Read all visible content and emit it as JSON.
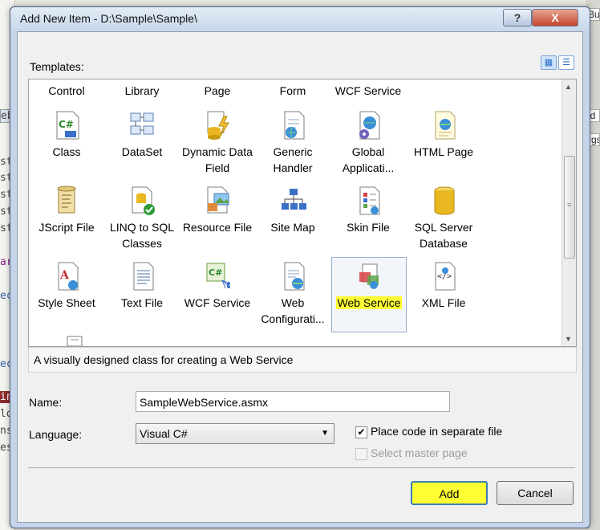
{
  "background": {
    "code_lines": [
      "st",
      "st",
      "st",
      "st",
      "st",
      "ar",
      "ec",
      "ec",
      "in",
      "lo",
      "ns",
      "es"
    ],
    "right_tabs": [
      "Bu",
      "id",
      "rgs"
    ],
    "left_tab": "eb"
  },
  "dialog": {
    "title": "Add New Item - D:\\Sample\\Sample\\",
    "help_label": "?",
    "close_label": "X",
    "templates_label": "Templates:",
    "view_buttons": [
      "large-icons-view-icon",
      "small-icons-view-icon"
    ],
    "top_row_labels": [
      "Control",
      "Library",
      "Page",
      "Form",
      "WCF Service"
    ],
    "items": [
      {
        "label": "Class",
        "icon": "csharp-class-icon"
      },
      {
        "label": "DataSet",
        "icon": "dataset-icon"
      },
      {
        "label": "Dynamic Data Field",
        "icon": "dynamic-data-field-icon"
      },
      {
        "label": "Generic Handler",
        "icon": "generic-handler-icon"
      },
      {
        "label": "Global Applicati...",
        "icon": "global-application-icon"
      },
      {
        "label": "HTML Page",
        "icon": "html-page-icon"
      },
      {
        "label": "JScript File",
        "icon": "jscript-file-icon"
      },
      {
        "label": "LINQ to SQL Classes",
        "icon": "linq-to-sql-icon"
      },
      {
        "label": "Resource File",
        "icon": "resource-file-icon"
      },
      {
        "label": "Site Map",
        "icon": "site-map-icon"
      },
      {
        "label": "Skin File",
        "icon": "skin-file-icon"
      },
      {
        "label": "SQL Server Database",
        "icon": "sql-database-icon"
      },
      {
        "label": "Style Sheet",
        "icon": "style-sheet-icon"
      },
      {
        "label": "Text File",
        "icon": "text-file-icon"
      },
      {
        "label": "WCF Service",
        "icon": "wcf-service-icon"
      },
      {
        "label": "Web Configurati...",
        "icon": "web-config-icon"
      },
      {
        "label": "Web Service",
        "icon": "web-service-icon",
        "selected": true
      },
      {
        "label": "XML File",
        "icon": "xml-file-icon"
      }
    ],
    "description": "A visually designed class for creating a Web Service",
    "name_label": "Name:",
    "name_value": "SampleWebService.asmx",
    "language_label": "Language:",
    "language_value": "Visual C#",
    "place_code_label": "Place code in separate file",
    "place_code_checked": true,
    "master_page_label": "Select master page",
    "master_page_checked": false,
    "add_label": "Add",
    "cancel_label": "Cancel",
    "highlight_color": "#ffff33"
  }
}
